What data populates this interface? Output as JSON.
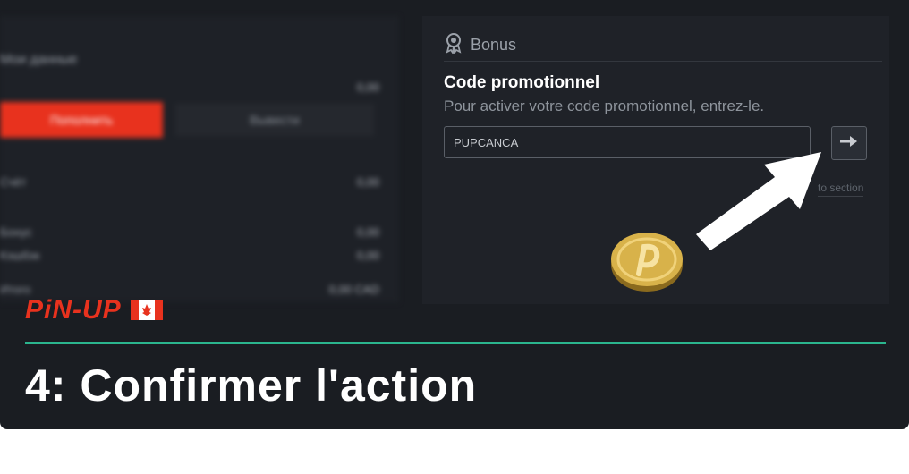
{
  "left": {
    "title": "Мои данные",
    "amount_top": "0,00",
    "btn_primary": "Пополнить",
    "btn_secondary": "Вывести",
    "rows": [
      {
        "label": "Счёт",
        "value": "0,00"
      },
      {
        "label": "Бонус",
        "value": "0,00"
      },
      {
        "label": "Кэшбэк",
        "value": "0,00"
      },
      {
        "label": "Итого",
        "value": "0,00 CAD"
      }
    ]
  },
  "bonus": {
    "header": "Bonus",
    "code_title": "Code promotionnel",
    "code_subtitle": "Pour activer votre code promotionnel, entrez-le.",
    "code_value": "PUPCANCA",
    "link_text": "to section"
  },
  "logo_text": "PiN-UP",
  "step_title": "4: Confirmer l'action",
  "colors": {
    "accent_red": "#e8321e",
    "divider_green": "#2bb58e",
    "background": "#1a1d22"
  }
}
